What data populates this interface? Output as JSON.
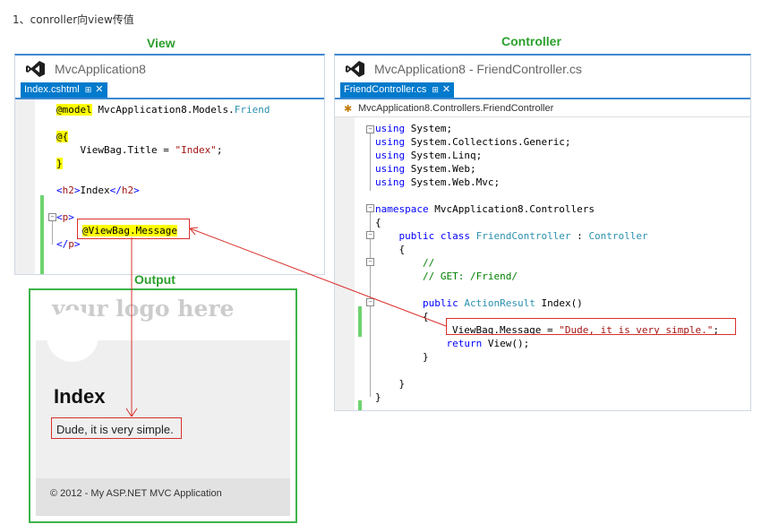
{
  "heading": "1、conroller向view传值",
  "captions": {
    "view": "View",
    "controller": "Controller",
    "output": "Output"
  },
  "view_pane": {
    "title": "MvcApplication8",
    "tab_label": "Index.cshtml",
    "tab_pin": "⊞",
    "tab_close": "✕",
    "code": {
      "l1_razor": "@model",
      "l1_ns": " MvcApplication8.Models.",
      "l1_type": "Friend",
      "l2_razor": "@{",
      "l3_a": "    ViewBag.Title = ",
      "l3_str": "\"Index\"",
      "l3_end": ";",
      "l4_razor": "}",
      "l5_open": "<",
      "l5_tag": "h2",
      "l5_close": ">",
      "l5_text": "Index",
      "l5_open2": "</",
      "l5_tag2": "h2",
      "l5_close2": ">",
      "l6_open": "<",
      "l6_tag": "p",
      "l6_close": ">",
      "l7": "@ViewBag.Message",
      "l8_open": "</",
      "l8_tag": "p",
      "l8_close": ">"
    }
  },
  "controller_pane": {
    "title": "MvcApplication8 - FriendController.cs",
    "tab_label": "FriendController.cs",
    "tab_pin": "⊞",
    "tab_close": "✕",
    "breadcrumb": "MvcApplication8.Controllers.FriendController",
    "code": {
      "u1_kw": "using",
      "u1": " System;",
      "u2_kw": "using",
      "u2": " System.Collections.Generic;",
      "u3_kw": "using",
      "u3": " System.Linq;",
      "u4_kw": "using",
      "u4": " System.Web;",
      "u5_kw": "using",
      "u5": " System.Web.Mvc;",
      "ns_kw": "namespace",
      "ns": " MvcApplication8.Controllers",
      "b1": "{",
      "cls_kw": "    public class ",
      "cls_name": "FriendController",
      "cls_sep": " : ",
      "cls_base": "Controller",
      "b2": "    {",
      "c1": "        //",
      "c2": "        // GET: /Friend/",
      "m_kw": "        public ",
      "m_type": "ActionResult",
      "m_name": " Index()",
      "b3": "        {",
      "s1_a": "ViewBag.Message = ",
      "s1_str": "\"Dude, it is very simple.\"",
      "s1_end": ";",
      "s2_kw": "            return",
      "s2": " View();",
      "b4": "        }",
      "b5": "    }",
      "b6": "}"
    }
  },
  "output": {
    "logo": "your logo here",
    "title": "Index",
    "message": "Dude, it is very simple.",
    "footer": "© 2012 - My ASP.NET MVC Application"
  },
  "colors": {
    "caption_green": "#2ca02c",
    "annotation_red": "#d9302c",
    "vs_blue": "#007acc",
    "output_border": "#3cb44b"
  }
}
